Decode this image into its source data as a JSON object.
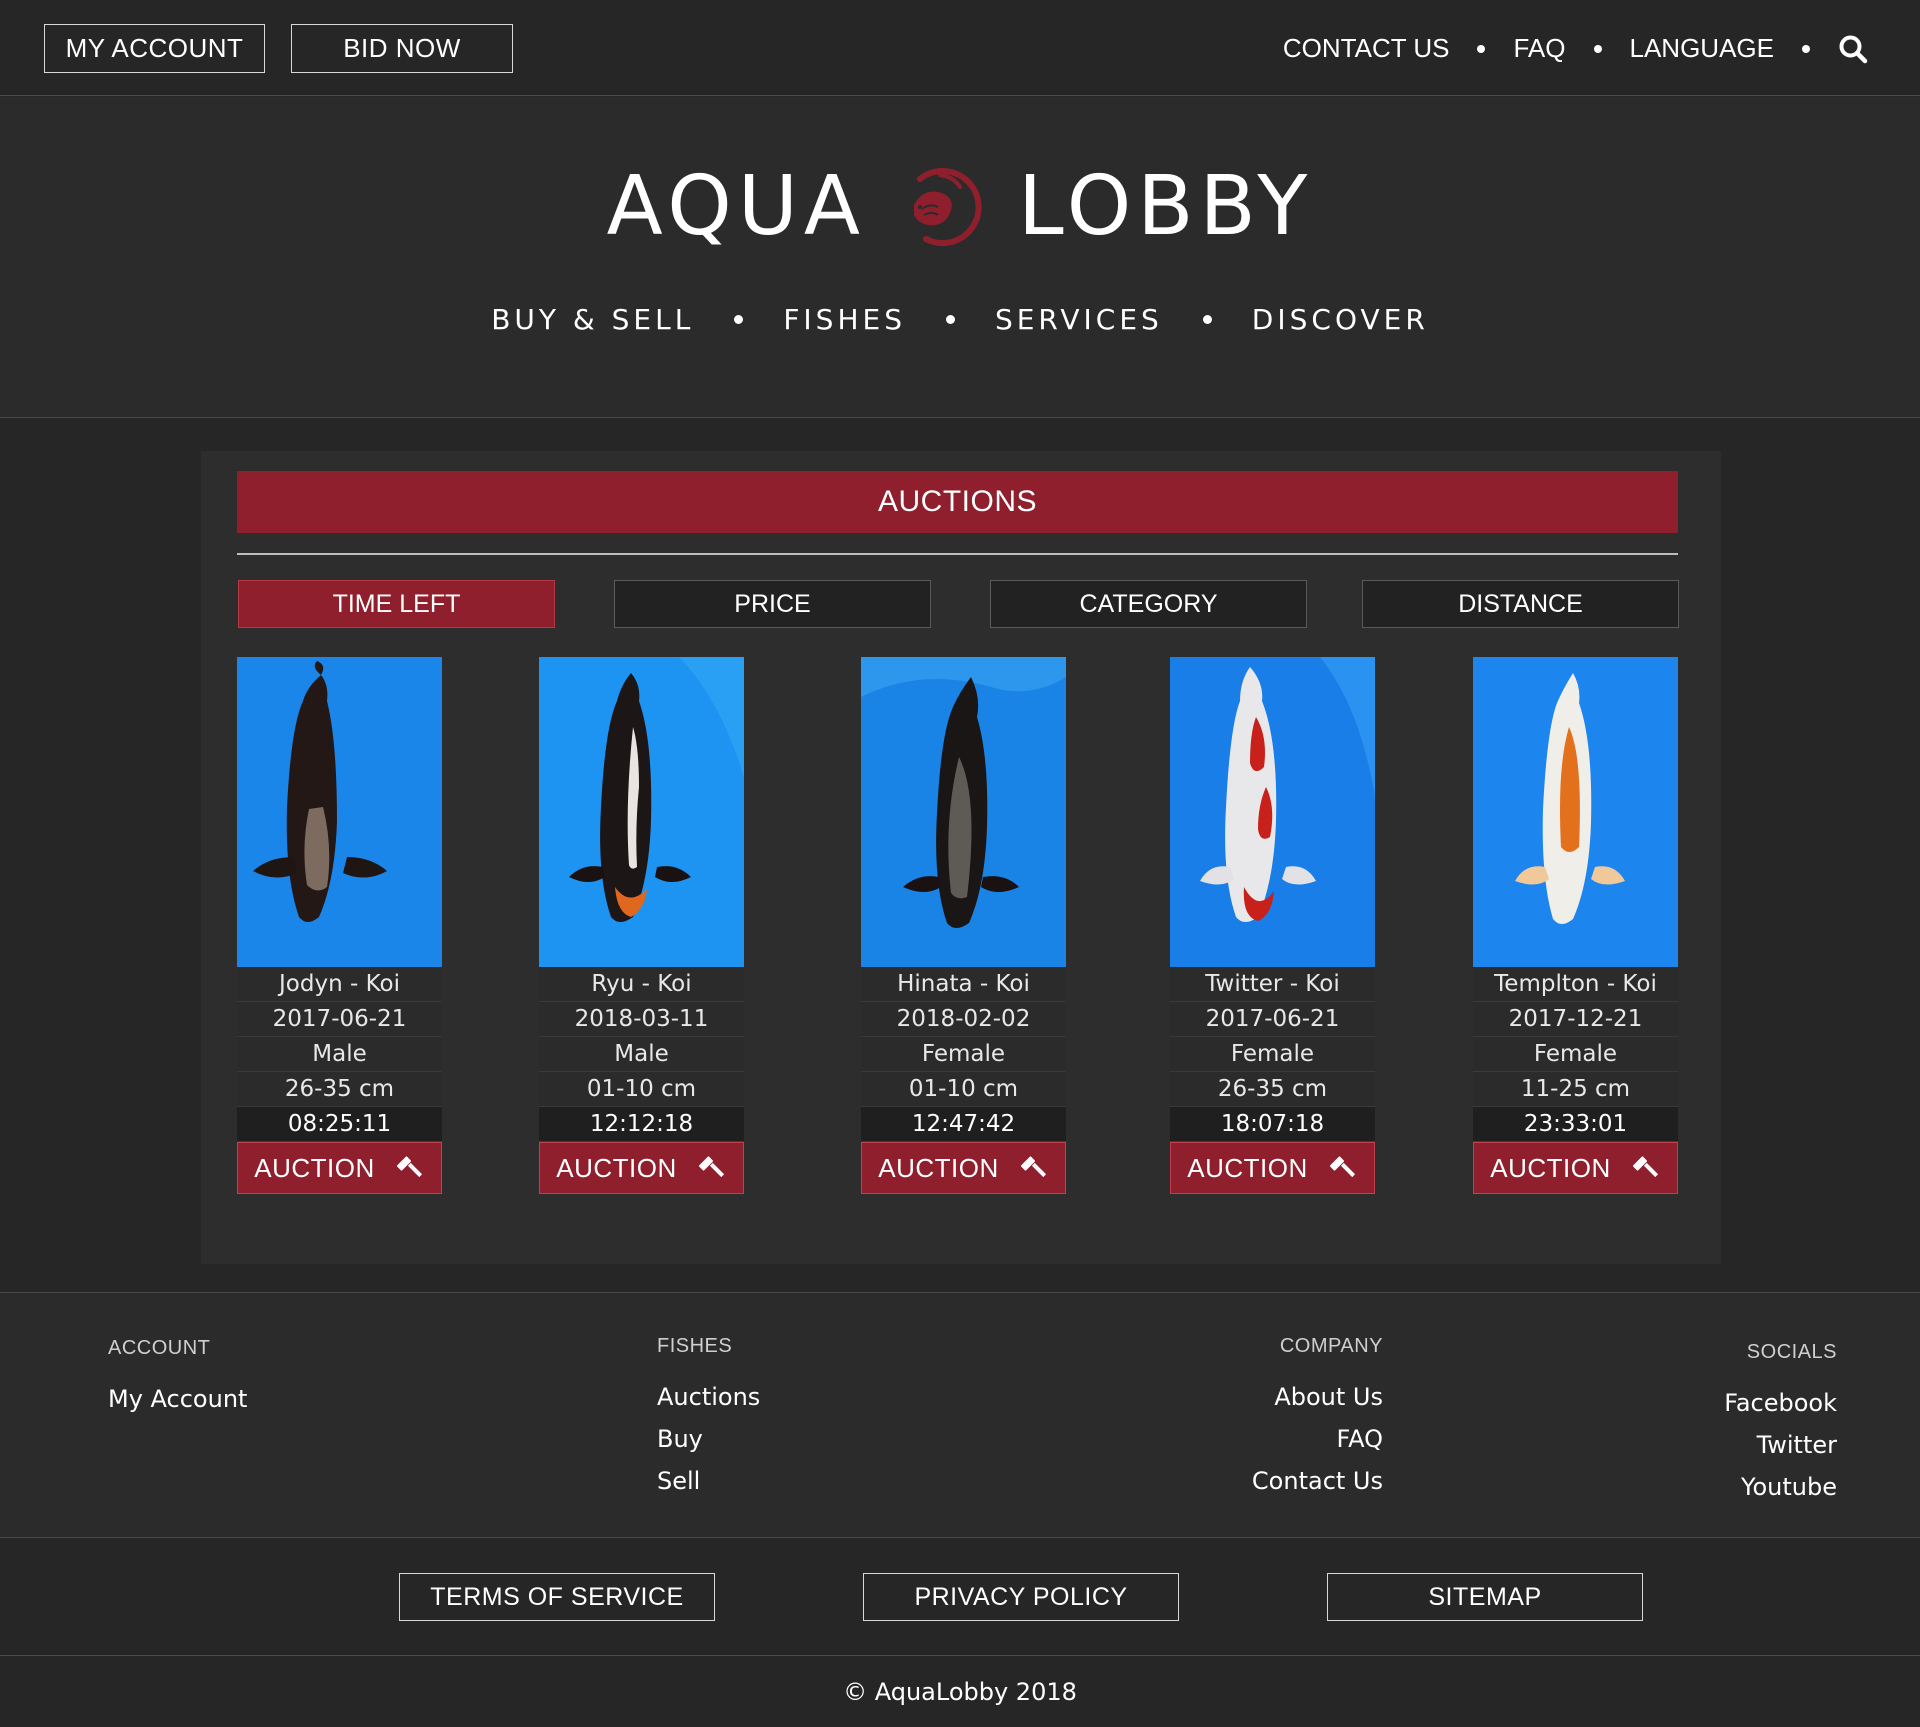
{
  "topbar": {
    "my_account_label": "MY ACCOUNT",
    "bid_now_label": "BID NOW",
    "nav": [
      "CONTACT US",
      "FAQ",
      "LANGUAGE"
    ],
    "search_icon": "search-icon"
  },
  "brand": {
    "logo_left": "AQUA",
    "logo_right": "LOBBY",
    "logo_icon": "koi-emblem-icon",
    "nav": [
      "BUY & SELL",
      "FISHES",
      "SERVICES",
      "DISCOVER"
    ]
  },
  "auctions": {
    "title": "AUCTIONS",
    "sort_options": [
      "TIME LEFT",
      "PRICE",
      "CATEGORY",
      "DISTANCE"
    ],
    "active_sort": "TIME LEFT",
    "button_label": "AUCTION",
    "button_icon": "gavel-icon",
    "items": [
      {
        "name": "Jodyn - Koi",
        "date": "2017-06-21",
        "sex": "Male",
        "size": "26-35 cm",
        "time_left": "08:25:11"
      },
      {
        "name": "Ryu - Koi",
        "date": "2018-03-11",
        "sex": "Male",
        "size": "01-10 cm",
        "time_left": "12:12:18"
      },
      {
        "name": "Hinata - Koi",
        "date": "2018-02-02",
        "sex": "Female",
        "size": "01-10 cm",
        "time_left": "12:47:42"
      },
      {
        "name": "Twitter - Koi",
        "date": "2017-06-21",
        "sex": "Female",
        "size": "26-35 cm",
        "time_left": "18:07:18"
      },
      {
        "name": "Templton - Koi",
        "date": "2017-12-21",
        "sex": "Female",
        "size": "11-25 cm",
        "time_left": "23:33:01"
      }
    ]
  },
  "footer": {
    "account": {
      "heading": "ACCOUNT",
      "links": [
        "My Account"
      ]
    },
    "fishes": {
      "heading": "FISHES",
      "links": [
        "Auctions",
        "Buy",
        "Sell"
      ]
    },
    "company": {
      "heading": "COMPANY",
      "links": [
        "About Us",
        "FAQ",
        "Contact Us"
      ]
    },
    "socials": {
      "heading": "SOCIALS",
      "links": [
        "Facebook",
        "Twitter",
        "Youtube"
      ]
    }
  },
  "legal": {
    "terms_label": "TERMS OF SERVICE",
    "privacy_label": "PRIVACY POLICY",
    "sitemap_label": "SITEMAP"
  },
  "copyright": "© AquaLobby 2018",
  "colors": {
    "accent": "#901f2e",
    "background": "#262626",
    "panel": "#2d2d2d",
    "water": "#1d8ff0"
  }
}
